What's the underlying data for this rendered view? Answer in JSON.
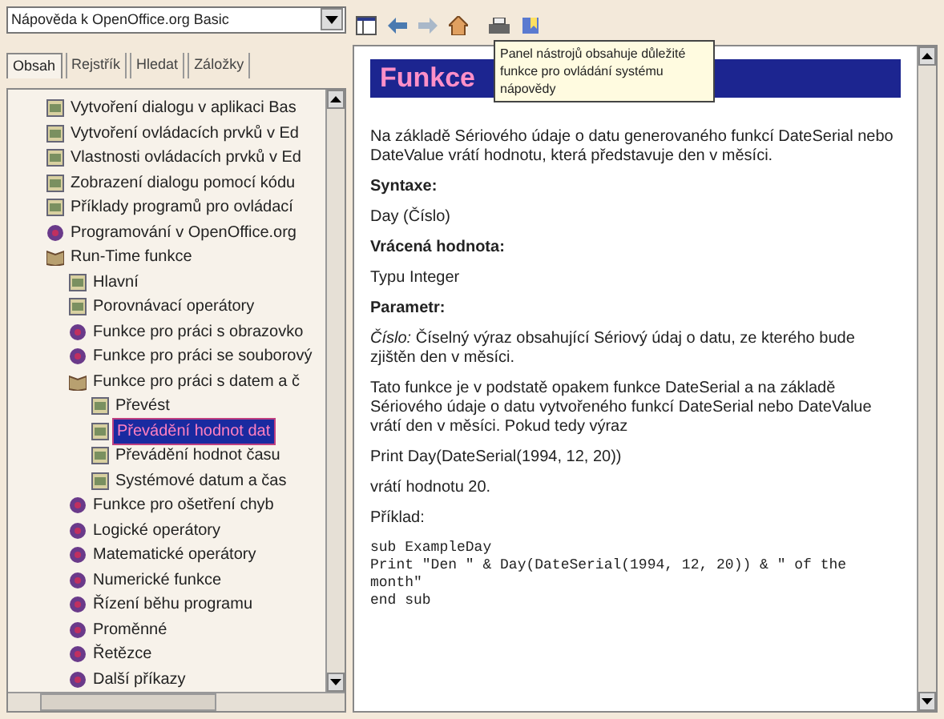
{
  "module_select": {
    "value": "Nápověda k OpenOffice.org Basic"
  },
  "nav_tabs": [
    {
      "label": "Obsah",
      "selected": true
    },
    {
      "label": "Rejstřík",
      "selected": false
    },
    {
      "label": "Hledat",
      "selected": false
    },
    {
      "label": "Záložky",
      "selected": false
    }
  ],
  "tree": [
    {
      "label": "Vytvoření dialogu v aplikaci Bas",
      "kind": "page",
      "selected": false
    },
    {
      "label": "Vytvoření ovládacích prvků v Ed",
      "kind": "page",
      "selected": false
    },
    {
      "label": "Vlastnosti ovládacích prvků v Ed",
      "kind": "page",
      "selected": false
    },
    {
      "label": "Zobrazení dialogu pomocí kódu",
      "kind": "page",
      "selected": false
    },
    {
      "label": "Příklady programů pro ovládací",
      "kind": "page",
      "selected": false
    },
    {
      "label": "Programování v OpenOffice.org",
      "kind": "book",
      "selected": false
    },
    {
      "label": "Run-Time funkce",
      "kind": "folder",
      "expanded": true,
      "selected": false,
      "children": [
        {
          "label": "Hlavní",
          "kind": "page",
          "selected": false
        },
        {
          "label": "Porovnávací operátory",
          "kind": "page",
          "selected": false
        },
        {
          "label": "Funkce pro práci s obrazovko",
          "kind": "book",
          "selected": false
        },
        {
          "label": "Funkce pro práci se souborový",
          "kind": "book",
          "selected": false
        },
        {
          "label": "Funkce pro práci s datem a č",
          "kind": "folder",
          "expanded": true,
          "selected": false,
          "children": [
            {
              "label": "Převést",
              "kind": "page",
              "selected": false
            },
            {
              "label": "Převádění hodnot dat",
              "kind": "page",
              "selected": true
            },
            {
              "label": "Převádění hodnot času",
              "kind": "page",
              "selected": false
            },
            {
              "label": "Systémové datum a čas",
              "kind": "page",
              "selected": false
            }
          ]
        },
        {
          "label": "Funkce pro ošetření chyb",
          "kind": "book",
          "selected": false
        },
        {
          "label": "Logické operátory",
          "kind": "book",
          "selected": false
        },
        {
          "label": "Matematické operátory",
          "kind": "book",
          "selected": false
        },
        {
          "label": "Numerické funkce",
          "kind": "book",
          "selected": false
        },
        {
          "label": "Řízení běhu programu",
          "kind": "book",
          "selected": false
        },
        {
          "label": "Proměnné",
          "kind": "book",
          "selected": false
        },
        {
          "label": "Řetězce",
          "kind": "book",
          "selected": false
        },
        {
          "label": "Další příkazy",
          "kind": "book",
          "selected": false
        }
      ]
    }
  ],
  "tooltip": "Panel nástrojů obsahuje důležité funkce pro ovládání systému nápovědy",
  "document": {
    "heading": "Funkce",
    "blocks": [
      {
        "kind": "para",
        "text": "Na základě Sériového údaje o datu generovaného funkcí DateSerial nebo DateValue vrátí hodnotu, která představuje den v měsíci."
      },
      {
        "kind": "label",
        "text": "Syntaxe:"
      },
      {
        "kind": "para",
        "text": "Day (Číslo)"
      },
      {
        "kind": "label",
        "text": "Vrácená hodnota:"
      },
      {
        "kind": "para",
        "text": "Typu Integer"
      },
      {
        "kind": "label",
        "text": "Parametr:"
      },
      {
        "kind": "para",
        "text": "*Číslo:* Číselný výraz obsahující Sériový údaj o datu, ze kterého bude zjištěn den v měsíci."
      },
      {
        "kind": "para",
        "text": "Tato funkce je v podstatě opakem funkce DateSerial a na základě Sériového údaje o datu vytvořeného funkcí DateSerial nebo DateValue vrátí den v měsíci. Pokud tedy výraz"
      },
      {
        "kind": "para",
        "text": "Print Day(DateSerial(1994, 12, 20))"
      },
      {
        "kind": "para",
        "text": "vrátí hodnotu 20."
      },
      {
        "kind": "para",
        "text": "Příklad:"
      },
      {
        "kind": "code",
        "text": "sub ExampleDay\nPrint \"Den \" & Day(DateSerial(1994, 12, 20)) & \" of the month\"\nend sub"
      }
    ]
  }
}
